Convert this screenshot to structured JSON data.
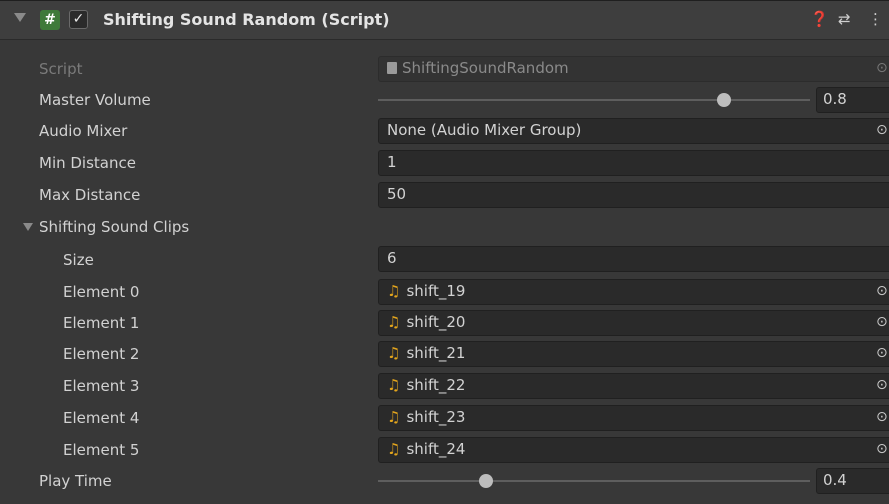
{
  "header": {
    "title": "Shifting Sound Random (Script)",
    "script_icon": "#",
    "enabled_check": "✓",
    "icons": [
      "help-icon",
      "preset-icon",
      "more-icon"
    ]
  },
  "script_row": {
    "label": "Script",
    "value": "ShiftingSoundRandom"
  },
  "master_volume": {
    "label": "Master Volume",
    "value": "0.8",
    "fraction": 0.8
  },
  "audio_mixer": {
    "label": "Audio Mixer",
    "value": "None (Audio Mixer Group)"
  },
  "min_distance": {
    "label": "Min Distance",
    "value": "1"
  },
  "max_distance": {
    "label": "Max Distance",
    "value": "50"
  },
  "clips": {
    "label": "Shifting Sound Clips",
    "size_label": "Size",
    "size_value": "6",
    "elements": [
      {
        "label": "Element 0",
        "value": "shift_19"
      },
      {
        "label": "Element 1",
        "value": "shift_20"
      },
      {
        "label": "Element 2",
        "value": "shift_21"
      },
      {
        "label": "Element 3",
        "value": "shift_22"
      },
      {
        "label": "Element 4",
        "value": "shift_23"
      },
      {
        "label": "Element 5",
        "value": "shift_24"
      }
    ]
  },
  "play_time": {
    "label": "Play Time",
    "value": "0.4",
    "fraction": 0.25
  },
  "colors": {
    "background": "#383838",
    "field": "#2a2a2a",
    "audio_icon": "#e3a51d",
    "script_icon_bg": "#3f7a3a"
  }
}
